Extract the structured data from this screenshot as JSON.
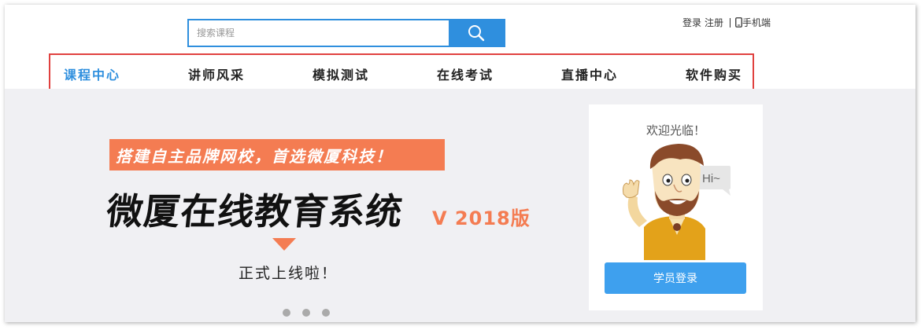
{
  "search": {
    "placeholder": "搜索课程"
  },
  "toplinks": {
    "login": "登录",
    "register": "注册",
    "mobile": "手机端"
  },
  "nav": {
    "items": [
      {
        "label": "课程中心"
      },
      {
        "label": "讲师风采"
      },
      {
        "label": "模拟测试"
      },
      {
        "label": "在线考试"
      },
      {
        "label": "直播中心"
      },
      {
        "label": "软件购买"
      }
    ]
  },
  "banner": {
    "tagline": "搭建自主品牌网校，首选微厦科技！",
    "headline": "微厦在线教育系统",
    "version": "V 2018版",
    "subline": "正式上线啦！"
  },
  "card": {
    "welcome": "欢迎光临！",
    "bubble": "Hi~",
    "login_button": "学员登录"
  },
  "colors": {
    "accent_blue": "#2f8fde",
    "nav_border_red": "#e0413f",
    "banner_orange": "#f47c52",
    "login_button_blue": "#3ea0ee",
    "banner_bg": "#f0f0f3"
  }
}
